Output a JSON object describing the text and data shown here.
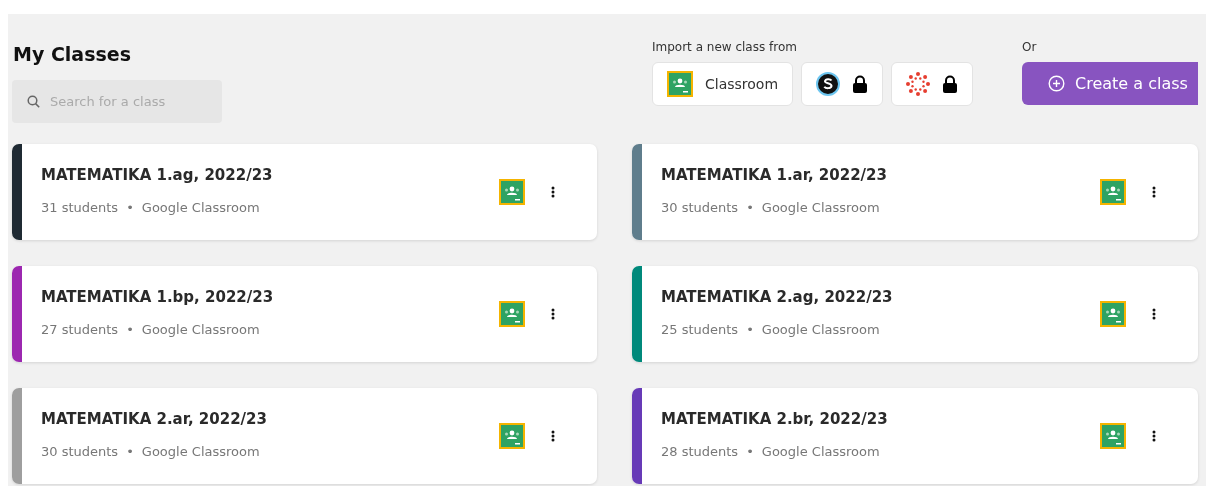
{
  "header": {
    "title": "My Classes",
    "search": {
      "placeholder": "Search for a class"
    }
  },
  "import": {
    "label": "Import a new class from",
    "sources": [
      {
        "kind": "classroom",
        "label": "Classroom",
        "locked": false
      },
      {
        "kind": "schoology",
        "locked": true
      },
      {
        "kind": "canvas",
        "locked": true
      }
    ]
  },
  "create": {
    "or_label": "Or",
    "button": "Create a class"
  },
  "classes": [
    {
      "name": "MATEMATIKA 1.ag, 2022/23",
      "students": "31 students",
      "separator": "•",
      "source": "Google Classroom",
      "color": "#1f2a33"
    },
    {
      "name": "MATEMATIKA 1.ar, 2022/23",
      "students": "30 students",
      "separator": "•",
      "source": "Google Classroom",
      "color": "#5f7d8c"
    },
    {
      "name": "MATEMATIKA 1.bp, 2022/23",
      "students": "27 students",
      "separator": "•",
      "source": "Google Classroom",
      "color": "#9c27b0"
    },
    {
      "name": "MATEMATIKA 2.ag, 2022/23",
      "students": "25 students",
      "separator": "•",
      "source": "Google Classroom",
      "color": "#00897b"
    },
    {
      "name": "MATEMATIKA 2.ar, 2022/23",
      "students": "30 students",
      "separator": "•",
      "source": "Google Classroom",
      "color": "#9e9e9e"
    },
    {
      "name": "MATEMATIKA 2.br, 2022/23",
      "students": "28 students",
      "separator": "•",
      "source": "Google Classroom",
      "color": "#673ab7"
    }
  ]
}
